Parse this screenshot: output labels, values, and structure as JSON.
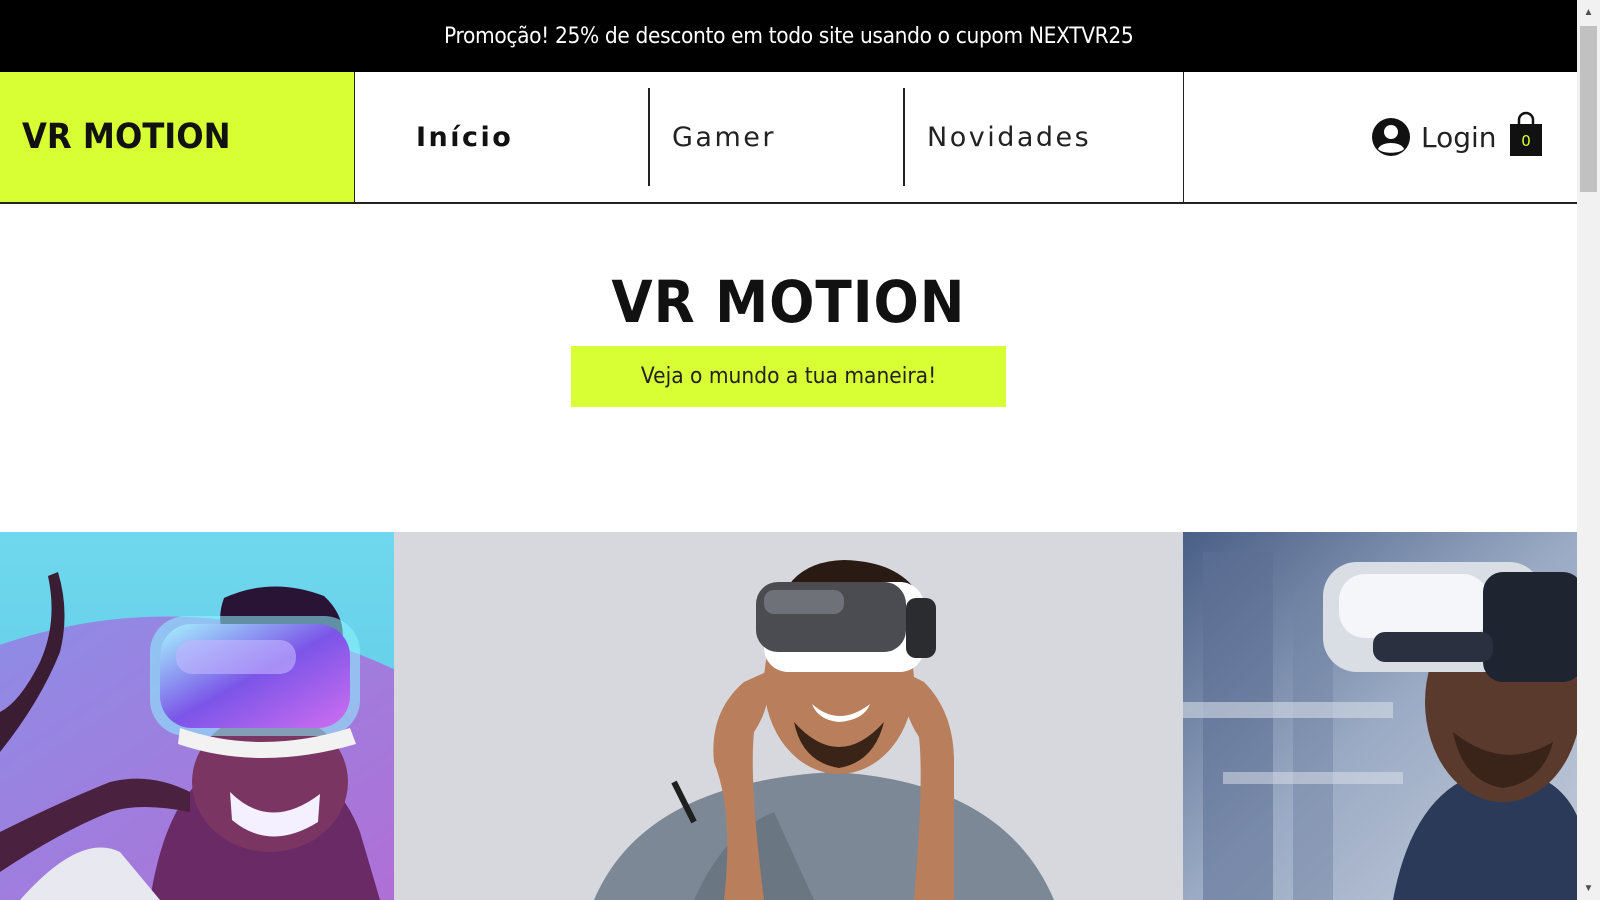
{
  "promo": {
    "text": "Promoção! 25% de desconto em todo site usando o cupom NEXTVR25"
  },
  "header": {
    "logo": "VR MOTION",
    "nav": [
      {
        "label": "Início",
        "active": true
      },
      {
        "label": "Gamer",
        "active": false
      },
      {
        "label": "Novidades",
        "active": false
      }
    ],
    "login_label": "Login",
    "cart_count": "0"
  },
  "hero": {
    "title": "VR MOTION",
    "subtitle": "Veja o mundo a tua maneira!"
  },
  "gallery": {
    "images": [
      {
        "icon": "vr-user-neon-photo"
      },
      {
        "icon": "vr-user-smiling-photo"
      },
      {
        "icon": "vr-user-industrial-photo"
      }
    ]
  },
  "colors": {
    "accent": "#d8ff34",
    "promo_bg": "#000000",
    "text": "#111111"
  }
}
